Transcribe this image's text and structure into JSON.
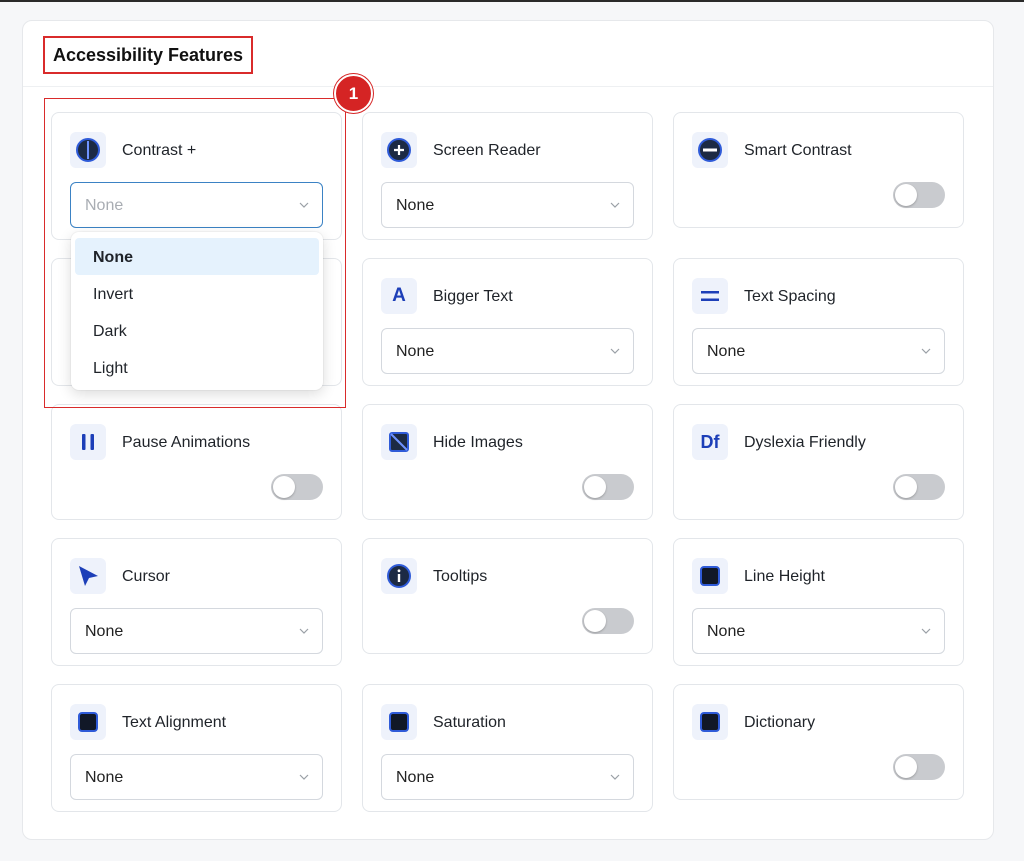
{
  "panel": {
    "title": "Accessibility Features"
  },
  "annotation": {
    "badge_number": "1"
  },
  "features": {
    "contrast": {
      "label": "Contrast +",
      "value": "None"
    },
    "screen_reader": {
      "label": "Screen Reader",
      "value": "None"
    },
    "smart_contrast": {
      "label": "Smart Contrast",
      "enabled": false
    },
    "bigger_text": {
      "label": "Bigger Text",
      "value": "None",
      "icon_text": "A"
    },
    "text_spacing": {
      "label": "Text Spacing",
      "value": "None"
    },
    "pause_animations": {
      "label": "Pause Animations",
      "enabled": false
    },
    "hide_images": {
      "label": "Hide Images",
      "enabled": false
    },
    "dyslexia_friendly": {
      "label": "Dyslexia Friendly",
      "enabled": false,
      "icon_text": "Df"
    },
    "cursor": {
      "label": "Cursor",
      "value": "None"
    },
    "tooltips": {
      "label": "Tooltips",
      "enabled": false
    },
    "line_height": {
      "label": "Line Height",
      "value": "None"
    },
    "text_alignment": {
      "label": "Text Alignment",
      "value": "None"
    },
    "saturation": {
      "label": "Saturation",
      "value": "None"
    },
    "dictionary": {
      "label": "Dictionary",
      "enabled": false
    }
  },
  "contrast_dropdown": {
    "options": [
      "None",
      "Invert",
      "Dark",
      "Light"
    ],
    "selected": "None"
  },
  "colors": {
    "accent": "#1d3fb8",
    "icon_bg": "#eef2fb",
    "annotation_red": "#d92b2b",
    "toggle_off": "#c9cbcf"
  }
}
